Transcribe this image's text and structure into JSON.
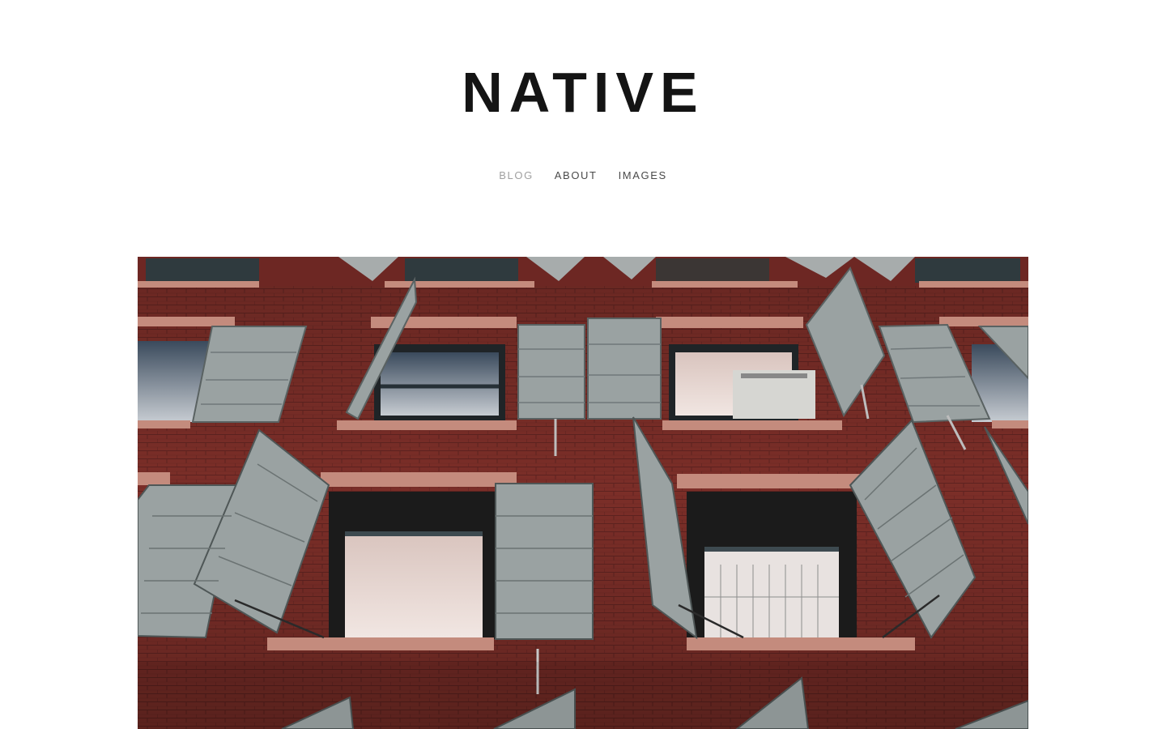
{
  "site": {
    "title": "NATIVE"
  },
  "nav": {
    "items": [
      {
        "label": "BLOG",
        "active": true
      },
      {
        "label": "ABOUT",
        "active": false
      },
      {
        "label": "IMAGES",
        "active": false
      }
    ]
  },
  "hero": {
    "subject": "red brick building facade with open grey wooden shutters",
    "colors": {
      "brick": "#7d2f2a",
      "sill": "#c98e80",
      "shutter": "#9aa3a3",
      "window": "#2b2b2b"
    }
  }
}
